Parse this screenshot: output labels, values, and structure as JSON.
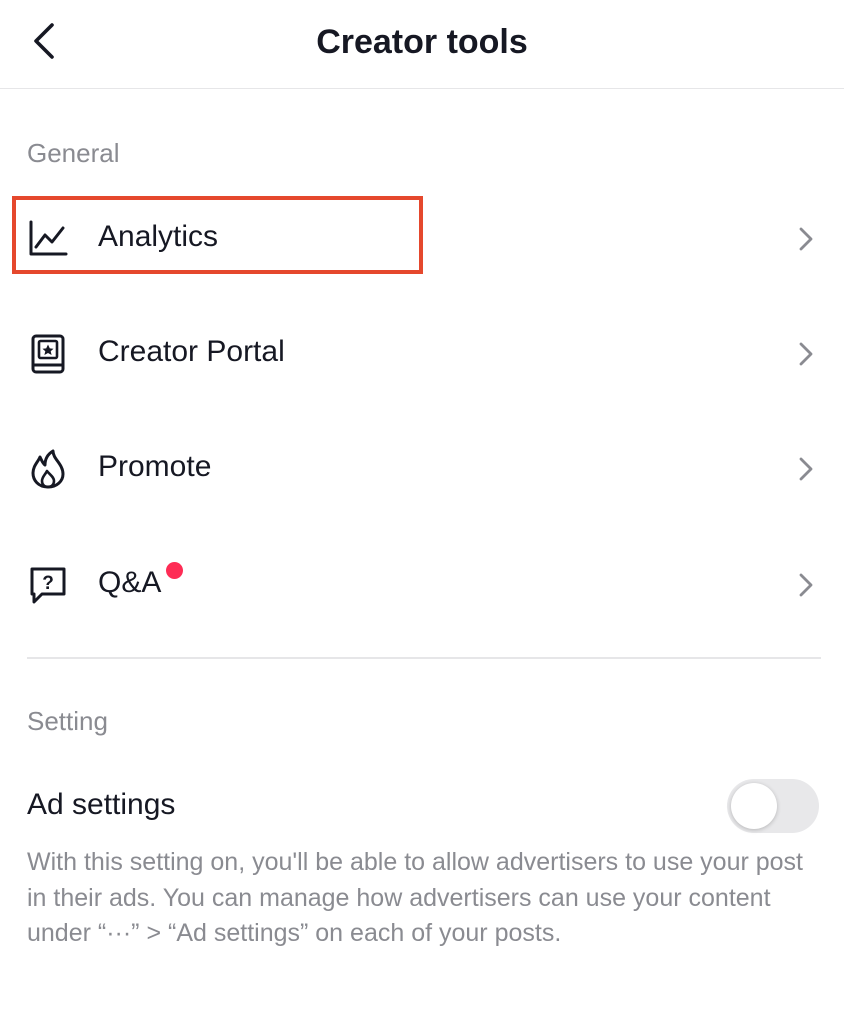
{
  "header": {
    "title": "Creator tools",
    "back_icon": "chevron-left-icon"
  },
  "sections": {
    "general": {
      "label": "General",
      "items": [
        {
          "label": "Analytics",
          "icon": "line-chart-icon",
          "highlighted": true
        },
        {
          "label": "Creator Portal",
          "icon": "portal-book-icon"
        },
        {
          "label": "Promote",
          "icon": "flame-icon"
        },
        {
          "label": "Q&A",
          "icon": "question-bubble-icon",
          "badge": "notification-dot"
        }
      ]
    },
    "setting": {
      "label": "Setting",
      "ad_settings": {
        "label": "Ad settings",
        "toggle_on": false,
        "description": "With this setting on, you'll be able to allow advertisers to use your post in their ads. You can manage how advertisers can use your content under “···” > “Ad settings” on each of your posts."
      }
    }
  },
  "colors": {
    "highlight": "#e5482d",
    "badge": "#fe2c55",
    "text_primary": "#161823",
    "text_secondary": "#8a8b91"
  }
}
